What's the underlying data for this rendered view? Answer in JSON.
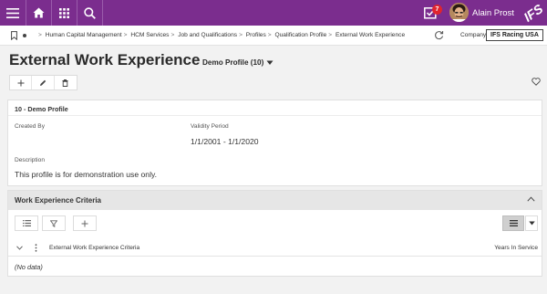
{
  "topbar": {
    "notification_count": "7",
    "user_name": "Alain Prost",
    "brand_logo": "IFS",
    "background": "#7b2d8e"
  },
  "breadcrumb": {
    "items": [
      "Human Capital Management",
      "HCM Services",
      "Job and Qualifications",
      "Profiles",
      "Qualification Profile",
      "External Work Experience"
    ],
    "company_label": "Company",
    "company_value": "IFS Racing USA"
  },
  "page": {
    "title": "External Work Experience",
    "record_selector": "Demo Profile (10)"
  },
  "profile_card": {
    "header": "10 - Demo Profile",
    "created_by_label": "Created By",
    "created_by_value": "",
    "validity_label": "Validity Period",
    "validity_value": "1/1/2001 - 1/1/2020",
    "description_label": "Description",
    "description_value": "This profile is for demonstration use only."
  },
  "criteria_card": {
    "header": "Work Experience Criteria",
    "columns": [
      "External Work Experience Criteria",
      "Years In Service"
    ],
    "empty_text": "(No data)"
  }
}
